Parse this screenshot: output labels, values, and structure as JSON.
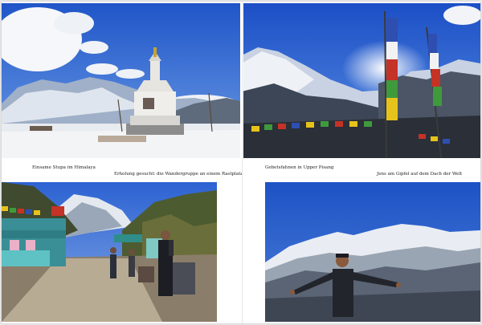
{
  "captions": {
    "stupa": "Einsame Stupa im Himalaya",
    "rest": "Erholung gesucht: die Wandergruppe an einem Rastplatz",
    "flags_left": "Gebetsfahnen in Upper Pisang",
    "flags_right": "Jens am Gipfel auf dem Dach der Welt"
  },
  "photos": [
    {
      "name": "stupa-photo",
      "subject": "white Buddhist stupa in snow with mountains behind"
    },
    {
      "name": "prayer-flags-photo",
      "subject": "prayer flags on poles above snowy mountain valley"
    },
    {
      "name": "village-trail-photo",
      "subject": "trekkers resting beside a village trail"
    },
    {
      "name": "mountain-summit-photo",
      "subject": "man with outstretched arms before snowy peaks"
    }
  ],
  "colors": {
    "sky": "#2a5fd0",
    "snow": "#f1f3f7",
    "flag_yellow": "#e6c31a",
    "flag_blue": "#2e4fb0",
    "flag_red": "#c53226",
    "flag_green": "#3f9a3c"
  }
}
